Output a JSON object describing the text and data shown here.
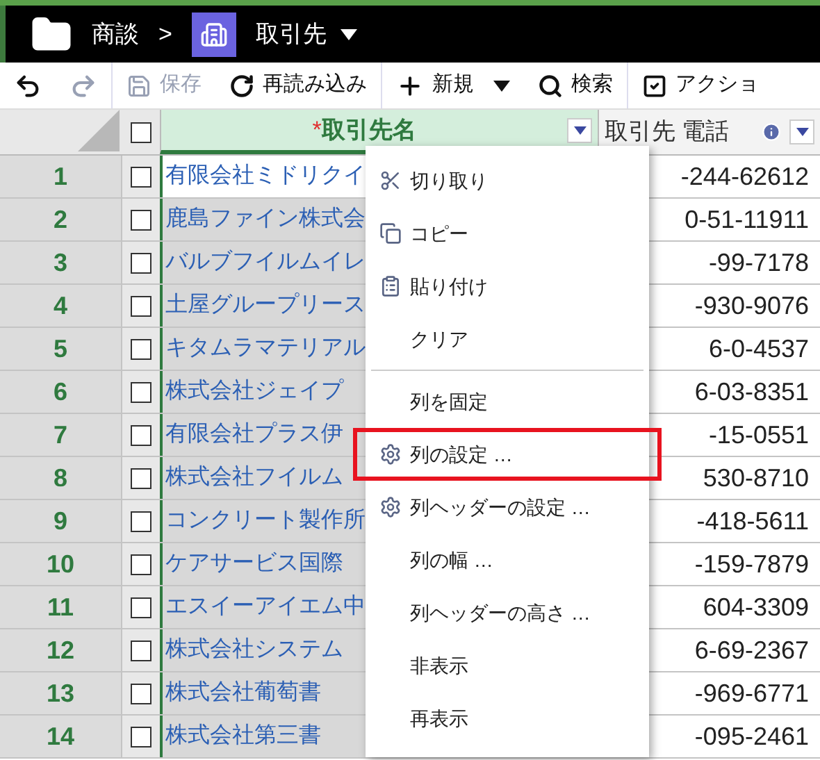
{
  "breadcrumb": {
    "parent": "商談",
    "separator": ">",
    "current": "取引先"
  },
  "toolbar": [
    {
      "kind": "undo",
      "disabled": false
    },
    {
      "kind": "redo",
      "disabled": true
    },
    {
      "kind": "save",
      "label": "保存",
      "disabled": true
    },
    {
      "kind": "reload",
      "label": "再読み込み",
      "disabled": false
    },
    {
      "kind": "new",
      "label": "新規",
      "disabled": false
    },
    {
      "kind": "search",
      "label": "検索",
      "disabled": false
    },
    {
      "kind": "action",
      "label": "アクショ",
      "disabled": false
    }
  ],
  "table": {
    "select_all_checked": false,
    "columns": [
      {
        "required_mark": "*",
        "label": "取引先名",
        "selected": true
      },
      {
        "label": "取引先 電話",
        "selected": false
      }
    ],
    "rows": [
      {
        "number": "1",
        "checked": false,
        "selected": true,
        "name": "有限会社ミドリクイ",
        "phone": "-244-62612"
      },
      {
        "number": "2",
        "checked": false,
        "selected": false,
        "name": "鹿島ファイン株式会",
        "phone": "0-51-11911"
      },
      {
        "number": "3",
        "checked": false,
        "selected": false,
        "name": "バルブフイルムイレ",
        "phone": "-99-7178"
      },
      {
        "number": "4",
        "checked": false,
        "selected": false,
        "name": "土屋グループリース",
        "phone": "-930-9076"
      },
      {
        "number": "5",
        "checked": false,
        "selected": false,
        "name": "キタムラマテリアル",
        "phone": "6-0-4537"
      },
      {
        "number": "6",
        "checked": false,
        "selected": false,
        "name": "株式会社ジェイプ",
        "phone": "6-03-8351"
      },
      {
        "number": "7",
        "checked": false,
        "selected": false,
        "name": "有限会社プラス伊",
        "phone": "-15-0551"
      },
      {
        "number": "8",
        "checked": false,
        "selected": false,
        "name": "株式会社フイルム",
        "phone": "530-8710"
      },
      {
        "number": "9",
        "checked": false,
        "selected": false,
        "name": "コンクリート製作所",
        "phone": "-418-5611"
      },
      {
        "number": "10",
        "checked": false,
        "selected": false,
        "name": "ケアサービス国際",
        "phone": "-159-7879"
      },
      {
        "number": "11",
        "checked": false,
        "selected": false,
        "name": "エスイーアイエム中",
        "phone": "604-3309"
      },
      {
        "number": "12",
        "checked": false,
        "selected": false,
        "name": "株式会社システム",
        "phone": "6-69-2367"
      },
      {
        "number": "13",
        "checked": false,
        "selected": false,
        "name": "株式会社葡萄書",
        "phone": "-969-6771"
      },
      {
        "number": "14",
        "checked": false,
        "selected": false,
        "name": "株式会社第三書",
        "phone": "-095-2461"
      }
    ]
  },
  "context_menu": [
    {
      "kind": "cut",
      "label": "切り取り",
      "highlighted": false
    },
    {
      "kind": "copy",
      "label": "コピー",
      "highlighted": false
    },
    {
      "kind": "paste",
      "label": "貼り付け",
      "highlighted": false
    },
    {
      "kind": "plain",
      "label": "クリア",
      "highlighted": false
    },
    {
      "kind": "separator"
    },
    {
      "kind": "plain",
      "label": "列を固定",
      "highlighted": false
    },
    {
      "kind": "settings",
      "label": "列の設定 …",
      "highlighted": true
    },
    {
      "kind": "settings",
      "label": "列ヘッダーの設定 …",
      "highlighted": false
    },
    {
      "kind": "plain",
      "label": "列の幅 …",
      "highlighted": false
    },
    {
      "kind": "plain",
      "label": "列ヘッダーの高さ …",
      "highlighted": false
    },
    {
      "kind": "plain",
      "label": "非表示",
      "highlighted": false
    },
    {
      "kind": "plain",
      "label": "再表示",
      "highlighted": false
    }
  ]
}
